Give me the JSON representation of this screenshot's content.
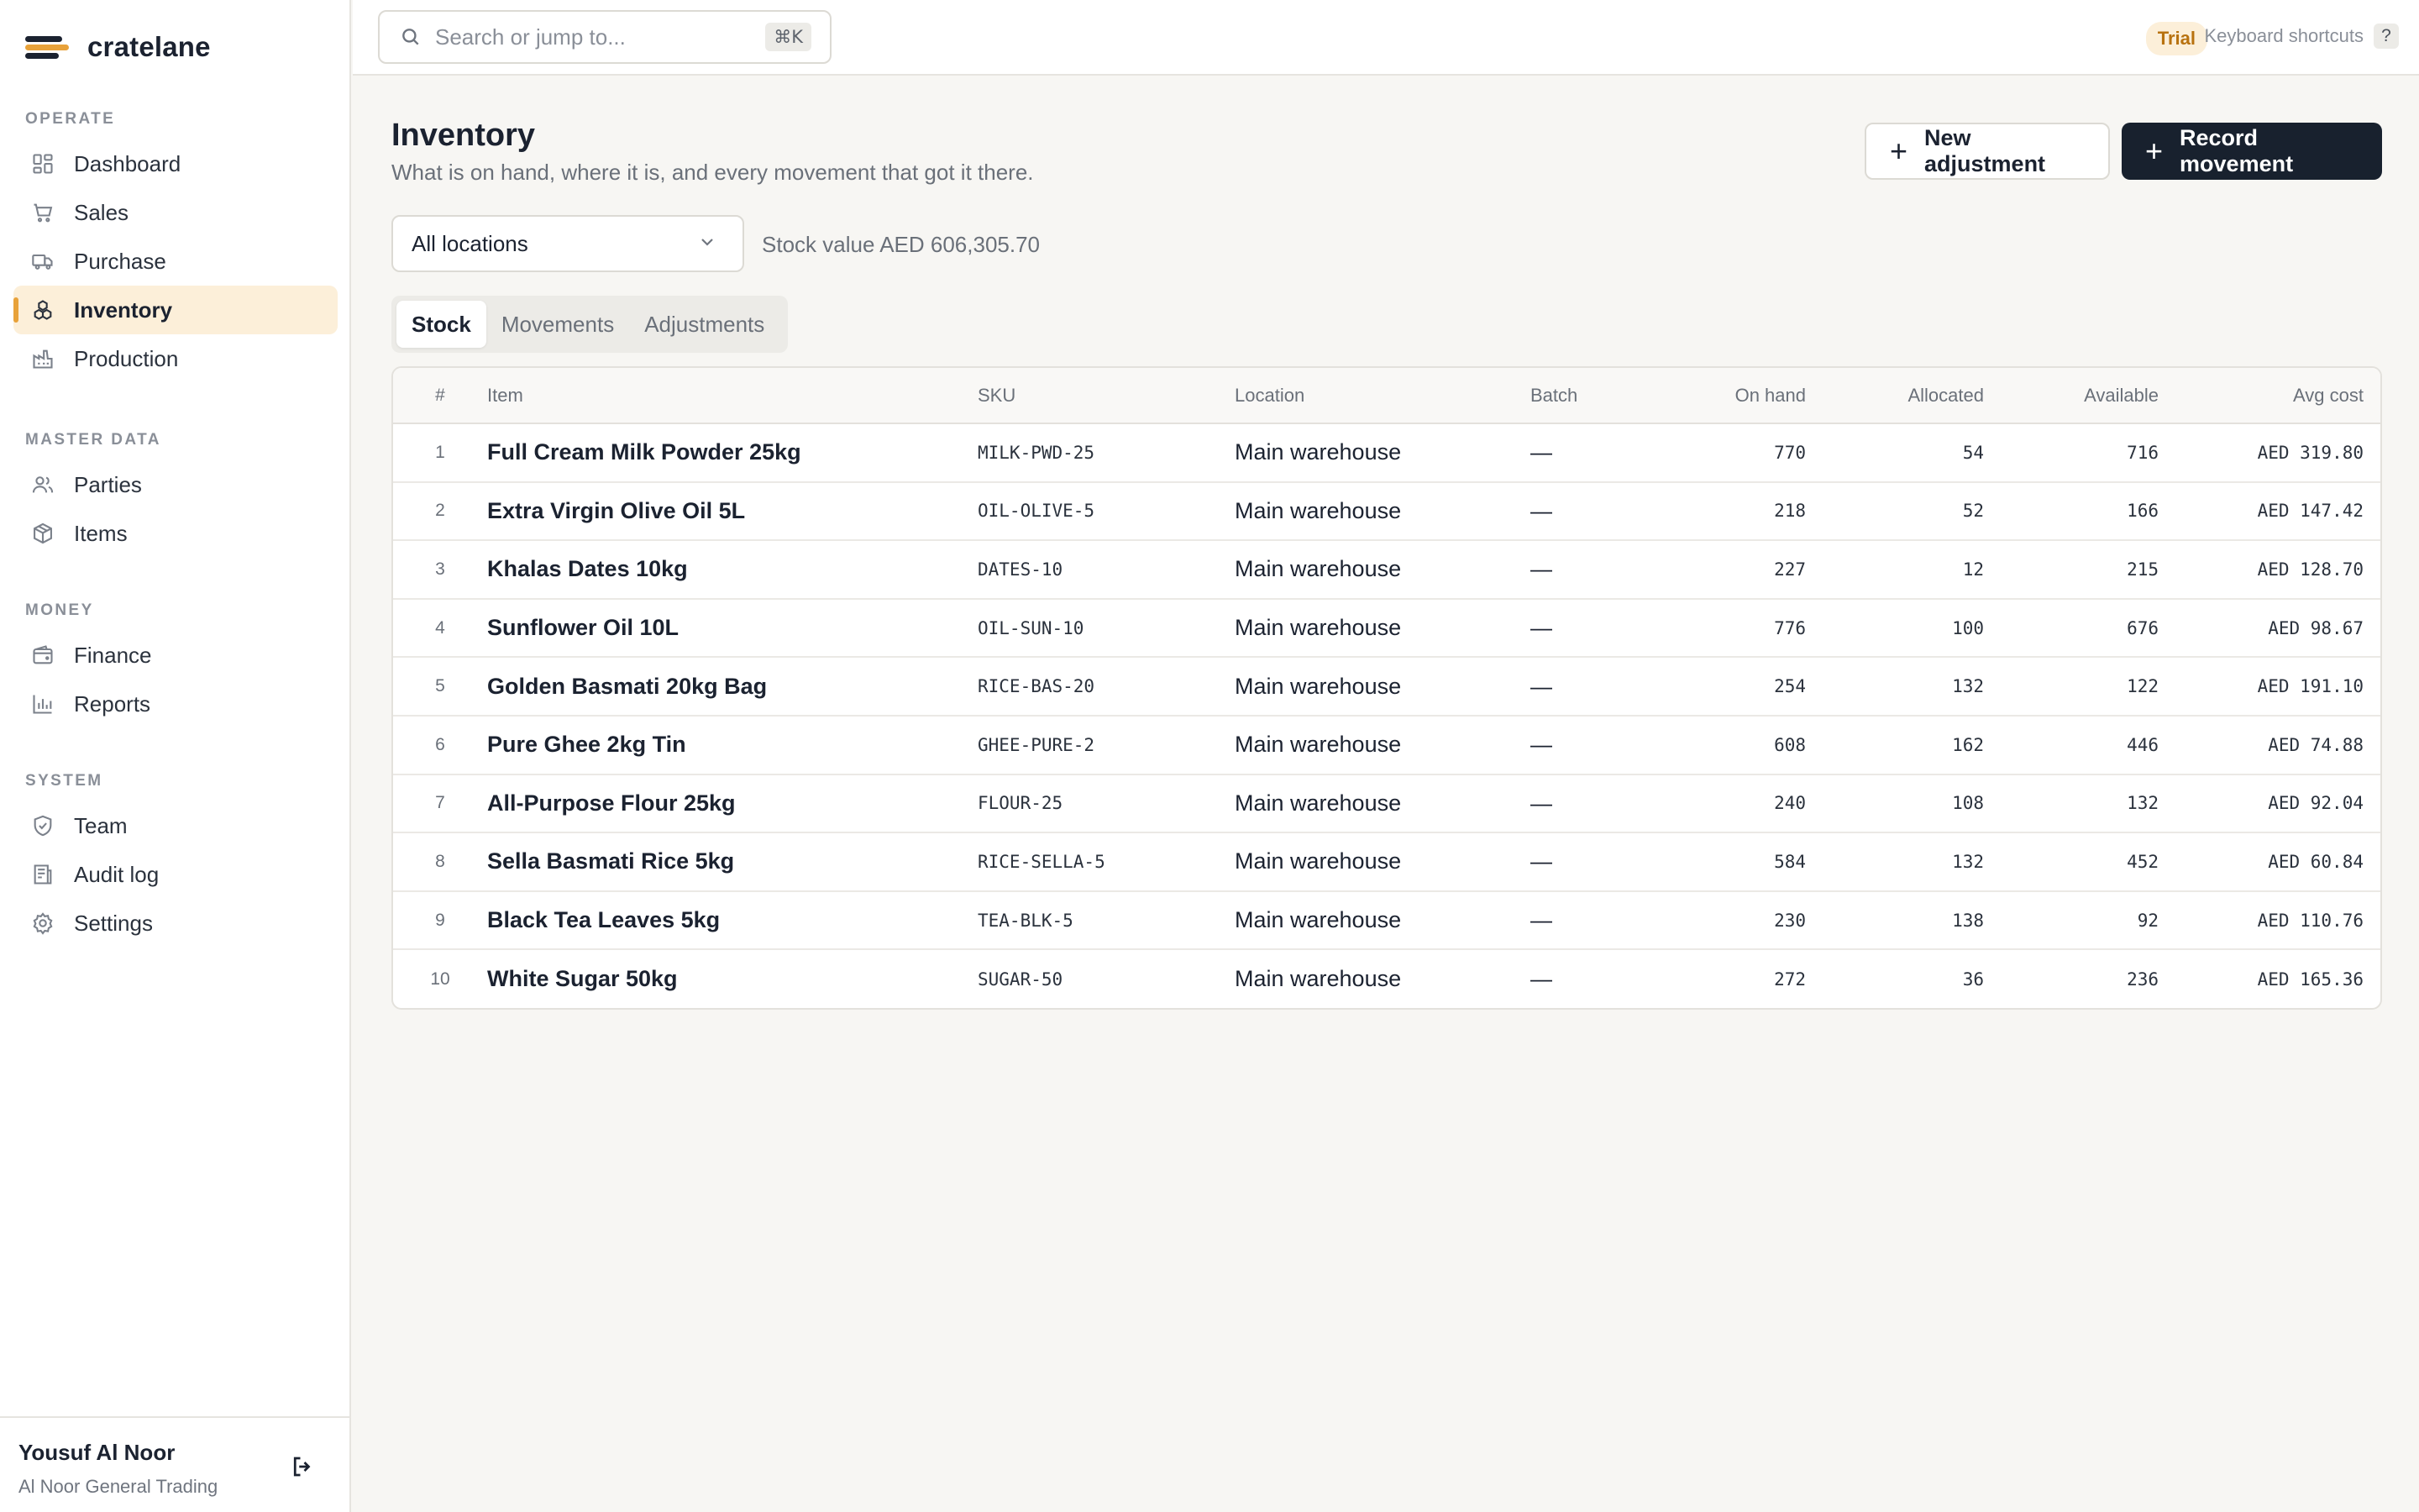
{
  "brand": {
    "name": "cratelane"
  },
  "sidebar": {
    "sections": [
      {
        "title": "OPERATE",
        "items": [
          {
            "label": "Dashboard",
            "icon": "dashboard-icon"
          },
          {
            "label": "Sales",
            "icon": "cart-icon"
          },
          {
            "label": "Purchase",
            "icon": "truck-icon"
          },
          {
            "label": "Inventory",
            "icon": "boxes-icon",
            "active": true
          },
          {
            "label": "Production",
            "icon": "factory-icon"
          }
        ]
      },
      {
        "title": "MASTER DATA",
        "items": [
          {
            "label": "Parties",
            "icon": "users-icon"
          },
          {
            "label": "Items",
            "icon": "package-icon"
          }
        ]
      },
      {
        "title": "MONEY",
        "items": [
          {
            "label": "Finance",
            "icon": "wallet-icon"
          },
          {
            "label": "Reports",
            "icon": "bar-chart-icon"
          }
        ]
      },
      {
        "title": "SYSTEM",
        "items": [
          {
            "label": "Team",
            "icon": "shield-icon"
          },
          {
            "label": "Audit log",
            "icon": "audit-log-icon"
          },
          {
            "label": "Settings",
            "icon": "gear-icon"
          }
        ]
      }
    ],
    "user": {
      "name": "Yousuf Al Noor",
      "org": "Al Noor General Trading"
    }
  },
  "topbar": {
    "search_placeholder": "Search or jump to...",
    "search_shortcut": "⌘K",
    "trial_badge": "Trial",
    "shortcuts_label": "Keyboard shortcuts",
    "shortcuts_key": "?"
  },
  "page": {
    "title": "Inventory",
    "subtitle": "What is on hand, where it is, and every movement that got it there.",
    "new_adjustment_label": "New adjustment",
    "record_movement_label": "Record movement",
    "location_filter": "All locations",
    "stock_value": "Stock value AED 606,305.70",
    "tabs": [
      "Stock",
      "Movements",
      "Adjustments"
    ],
    "active_tab": "Stock"
  },
  "table": {
    "columns": [
      "#",
      "Item",
      "SKU",
      "Location",
      "Batch",
      "On hand",
      "Allocated",
      "Available",
      "Avg cost"
    ],
    "rows": [
      [
        "1",
        "Full Cream Milk Powder 25kg",
        "MILK-PWD-25",
        "Main warehouse",
        "—",
        "770",
        "54",
        "716",
        "AED 319.80"
      ],
      [
        "2",
        "Extra Virgin Olive Oil 5L",
        "OIL-OLIVE-5",
        "Main warehouse",
        "—",
        "218",
        "52",
        "166",
        "AED 147.42"
      ],
      [
        "3",
        "Khalas Dates 10kg",
        "DATES-10",
        "Main warehouse",
        "—",
        "227",
        "12",
        "215",
        "AED 128.70"
      ],
      [
        "4",
        "Sunflower Oil 10L",
        "OIL-SUN-10",
        "Main warehouse",
        "—",
        "776",
        "100",
        "676",
        "AED 98.67"
      ],
      [
        "5",
        "Golden Basmati 20kg Bag",
        "RICE-BAS-20",
        "Main warehouse",
        "—",
        "254",
        "132",
        "122",
        "AED 191.10"
      ],
      [
        "6",
        "Pure Ghee 2kg Tin",
        "GHEE-PURE-2",
        "Main warehouse",
        "—",
        "608",
        "162",
        "446",
        "AED 74.88"
      ],
      [
        "7",
        "All-Purpose Flour 25kg",
        "FLOUR-25",
        "Main warehouse",
        "—",
        "240",
        "108",
        "132",
        "AED 92.04"
      ],
      [
        "8",
        "Sella Basmati Rice 5kg",
        "RICE-SELLA-5",
        "Main warehouse",
        "—",
        "584",
        "132",
        "452",
        "AED 60.84"
      ],
      [
        "9",
        "Black Tea Leaves 5kg",
        "TEA-BLK-5",
        "Main warehouse",
        "—",
        "230",
        "138",
        "92",
        "AED 110.76"
      ],
      [
        "10",
        "White Sugar 50kg",
        "SUGAR-50",
        "Main warehouse",
        "—",
        "272",
        "36",
        "236",
        "AED 165.36"
      ]
    ]
  },
  "colors": {
    "accent": "#e8a23a",
    "active_nav_bg": "#fcefd9",
    "primary_button": "#18212e",
    "background": "#f7f6f3"
  }
}
